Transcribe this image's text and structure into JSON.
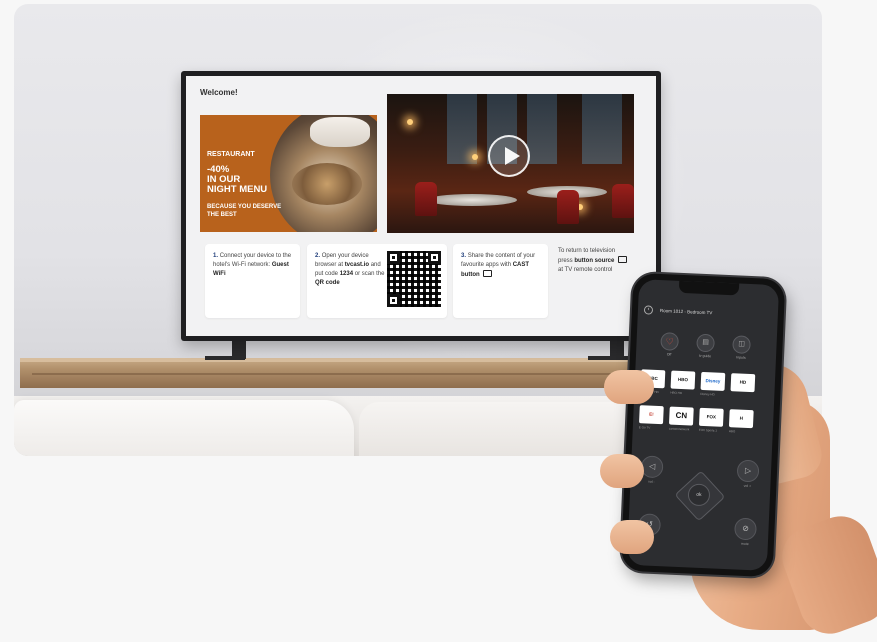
{
  "tv": {
    "welcome": "Welcome!",
    "promo": {
      "line1": "RESTAURANT",
      "line2": "-40%",
      "line3": "IN OUR",
      "line4": "NIGHT MENU",
      "line5": "BECAUSE YOU DESERVE",
      "line6": "THE BEST"
    },
    "steps": [
      {
        "num": "1.",
        "text": "Connect your device to the hotel's Wi-Fi network:",
        "highlight": "Guest WiFi"
      },
      {
        "num": "2.",
        "text_a": "Open your device browser at",
        "hl_a": "tvcast.io",
        "text_b": "and put code",
        "hl_b": "1234",
        "text_c": "or scan the",
        "hl_c": "QR code"
      },
      {
        "num": "3.",
        "text": "Share the content of your favourite apps with",
        "highlight": "CAST button"
      },
      {
        "text_a": "To return to television press",
        "hl": "button source",
        "text_b": "at TV remote control"
      }
    ]
  },
  "phone": {
    "header": "Room 1012 - Bedroom TV",
    "top_buttons": [
      "Off",
      "tv guide",
      "Inputs"
    ],
    "channels_row1": [
      {
        "logo": "BBC",
        "label": "Discovery HD"
      },
      {
        "logo": "HBO",
        "label": "HBO HD"
      },
      {
        "logo": "Disney",
        "label": "Disney HD"
      },
      {
        "logo": "HD",
        "label": ""
      }
    ],
    "channels_row2": [
      {
        "logo": "E!",
        "label": "E Go TV"
      },
      {
        "logo": "CN",
        "label": "cartoonnetwork"
      },
      {
        "logo": "FOX",
        "label": "FOX Sports 1"
      },
      {
        "logo": "H",
        "label": "HBO"
      }
    ],
    "controls": {
      "vol_down": "vol -",
      "vol_up": "vol +",
      "back": "back",
      "mute": "mute",
      "ok": "ok"
    }
  },
  "colors": {
    "promo_bg": "#b8621c",
    "accent_red": "#e74c3c",
    "step_number": "#1f3d7a"
  }
}
